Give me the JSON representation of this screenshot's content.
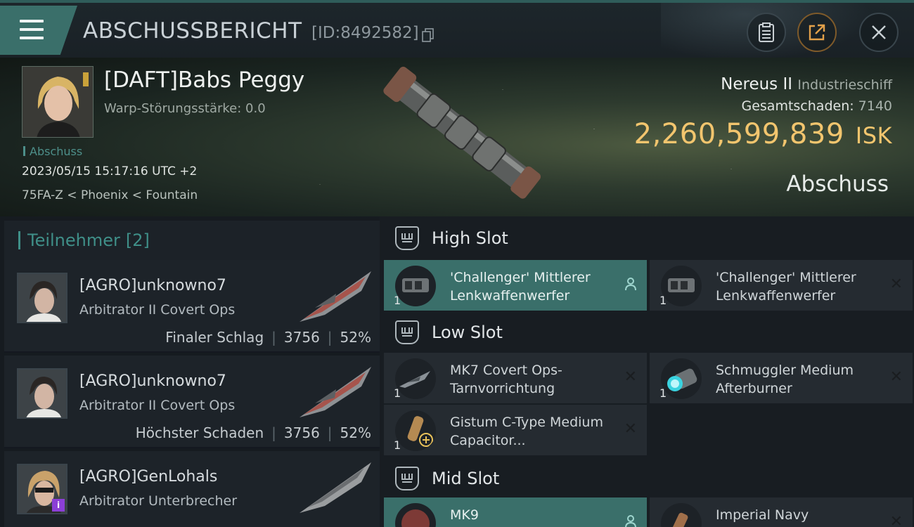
{
  "header": {
    "title": "ABSCHUSSBERICHT",
    "id": "[ID:8492582]",
    "icons": [
      "menu-icon",
      "copy-icon",
      "clipboard-icon",
      "share-icon",
      "close-icon"
    ]
  },
  "victim": {
    "name": "[DAFT]Babs Peggy",
    "warp": "Warp-Störungsstärke: 0.0",
    "tag": "Abschuss",
    "datetime": "2023/05/15 15:17:16 UTC +2",
    "location": "75FA-Z < Phoenix < Fountain",
    "ship": "Nereus II",
    "ship_class": "Industrieschiff",
    "total_damage_label": "Gesamtschaden:",
    "total_damage": "7140",
    "isk_value": "2,260,599,839",
    "isk_unit": "ISK",
    "result": "Abschuss"
  },
  "participants": {
    "header": "Teilnehmer",
    "count": "[2]",
    "rows": [
      {
        "name": "[AGRO]unknowno7",
        "ship": "Arbitrator II Covert Ops",
        "role": "Finaler Schlag",
        "damage": "3756",
        "percent": "52%"
      },
      {
        "name": "[AGRO]unknowno7",
        "ship": "Arbitrator II Covert Ops",
        "role": "Höchster Schaden",
        "damage": "3756",
        "percent": "52%"
      },
      {
        "name": "[AGRO]GenLohals",
        "ship": "Arbitrator Unterbrecher",
        "badge": "i"
      }
    ]
  },
  "fitting": {
    "high": {
      "label": "High Slot",
      "modules": [
        {
          "name": "'Challenger' Mittlerer Lenkwaffenwerfer",
          "qty": "1"
        },
        {
          "name": "'Challenger' Mittlerer Lenkwaffenwerfer",
          "qty": "1"
        }
      ]
    },
    "low": {
      "label": "Low Slot",
      "modules": [
        {
          "name": "MK7 Covert Ops-Tarnvorrichtung",
          "qty": "1"
        },
        {
          "name": "Schmuggler Medium Afterburner",
          "qty": "1"
        },
        {
          "name": "Gistum C-Type Medium Capacitor...",
          "qty": "1"
        }
      ]
    },
    "mid": {
      "label": "Mid Slot",
      "modules": [
        {
          "name": "MK9"
        },
        {
          "name": "Imperial Navy"
        }
      ]
    },
    "close_glyph": "✕"
  },
  "colors": {
    "accent": "#3a6f6a",
    "isk": "#f2c56e",
    "teal_text": "#3f8f88"
  }
}
